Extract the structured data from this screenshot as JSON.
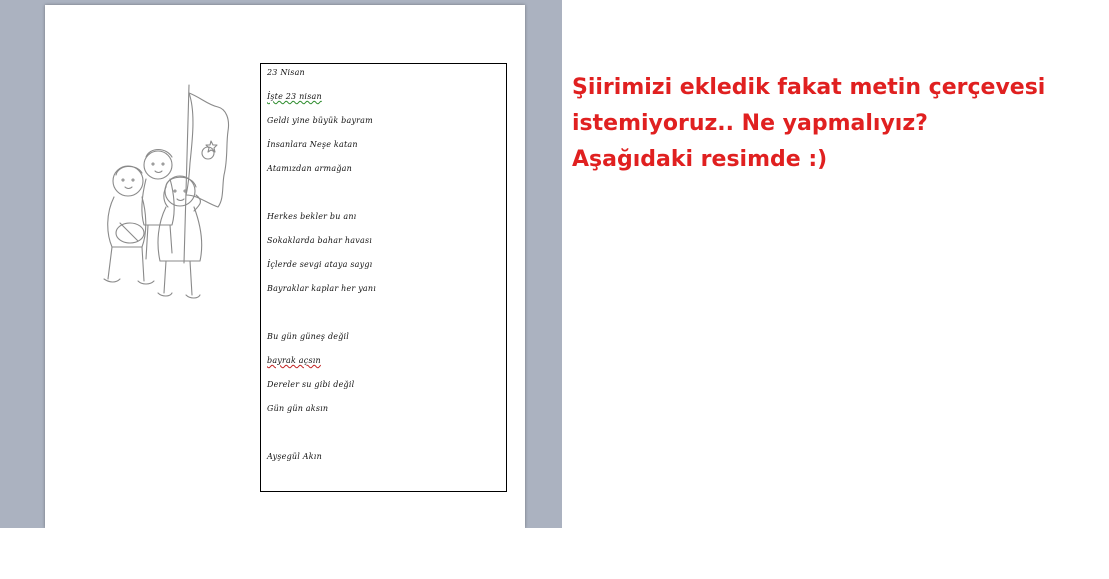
{
  "poem": {
    "stanza1": [
      "23 Nisan",
      "İşte 23 nisan",
      "Geldi yine büyük bayram",
      "İnsanlara Neşe katan",
      "Atamızdan armağan"
    ],
    "stanza2": [
      "Herkes bekler bu anı",
      "Sokaklarda bahar havası",
      "İçlerde sevgi ataya saygı",
      "Bayraklar kaplar her yanı"
    ],
    "stanza3": [
      "Bu gün güneş değil",
      "bayrak açsın",
      "Dereler su gibi değil",
      "Gün gün aksın"
    ],
    "author": "Ayşegül Akın"
  },
  "caption": {
    "line1": "Şiirimizi ekledik fakat metin çerçevesi",
    "line2": "istemiyoruz.. Ne yapmalıyız?",
    "line3": "Aşağıdaki resimde :)"
  },
  "colors": {
    "caption": "#e02020",
    "workspace": "#abb2c0",
    "page": "#ffffff",
    "frame_border": "#000000"
  },
  "icons": {
    "illustration": "children-with-flag-drawing"
  }
}
